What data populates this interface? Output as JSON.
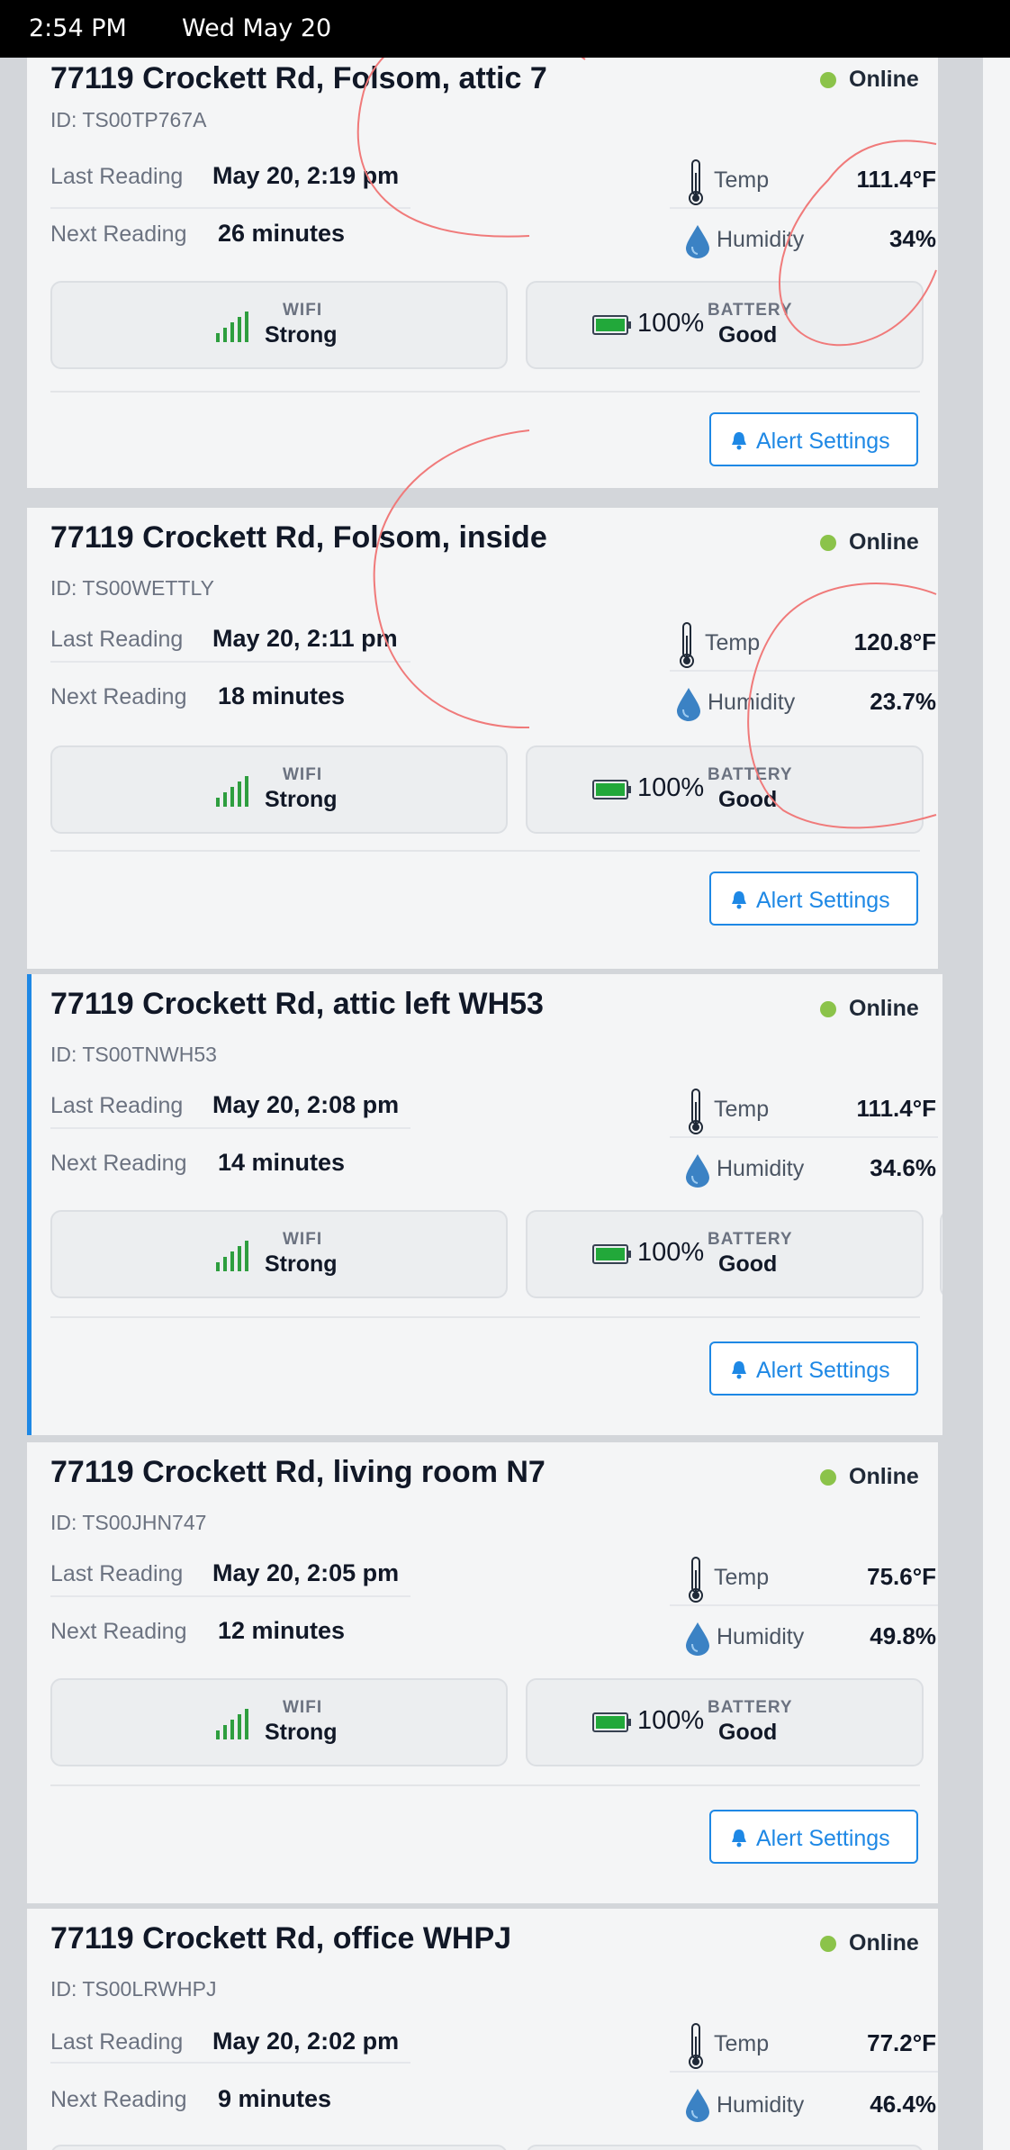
{
  "status_bar": {
    "time": "2:54 PM",
    "date": "Wed May 20"
  },
  "labels": {
    "id_prefix": "ID: ",
    "last_reading": "Last Reading",
    "next_reading": "Next Reading",
    "temp": "Temp",
    "humidity": "Humidity",
    "wifi": "WIFI",
    "battery": "BATTERY",
    "alert_settings": "Alert Settings"
  },
  "colors": {
    "accent": "#1e88e5",
    "online": "#8bc34a",
    "signal": "#2e9e3f",
    "battery_fill": "#22a83a"
  },
  "icons": [
    "thermometer-icon",
    "water-drop-icon",
    "wifi-signal-icon",
    "battery-icon",
    "bell-icon"
  ],
  "sensors": [
    {
      "title": "77119 Crockett Rd, Folsom, attic 7",
      "id": "ID: TS00TP767A",
      "status": "Online",
      "last_reading": "May 20, 2:19 pm",
      "next_reading": "26 minutes",
      "temp": "111.4°F",
      "humidity": "34%",
      "wifi": "Strong",
      "battery_pct": "100%",
      "battery": "Good"
    },
    {
      "title": "77119 Crockett Rd, Folsom, inside",
      "id": "ID: TS00WETTLY",
      "status": "Online",
      "last_reading": "May 20, 2:11 pm",
      "next_reading": "18 minutes",
      "temp": "120.8°F",
      "humidity": "23.7%",
      "wifi": "Strong",
      "battery_pct": "100%",
      "battery": "Good"
    },
    {
      "title": "77119 Crockett Rd, attic left WH53",
      "id": "ID: TS00TNWH53",
      "status": "Online",
      "last_reading": "May 20, 2:08 pm",
      "next_reading": "14 minutes",
      "temp": "111.4°F",
      "humidity": "34.6%",
      "wifi": "Strong",
      "battery_pct": "100%",
      "battery": "Good"
    },
    {
      "title": "77119 Crockett Rd, living room N7",
      "id": "ID: TS00JHN747",
      "status": "Online",
      "last_reading": "May 20, 2:05 pm",
      "next_reading": "12 minutes",
      "temp": "75.6°F",
      "humidity": "49.8%",
      "wifi": "Strong",
      "battery_pct": "100%",
      "battery": "Good"
    },
    {
      "title": "77119 Crockett Rd, office WHPJ",
      "id": "ID: TS00LRWHPJ",
      "status": "Online",
      "last_reading": "May 20, 2:02 pm",
      "next_reading": "9 minutes",
      "temp": "77.2°F",
      "humidity": "46.4%",
      "wifi": "",
      "battery_pct": "",
      "battery": ""
    }
  ]
}
